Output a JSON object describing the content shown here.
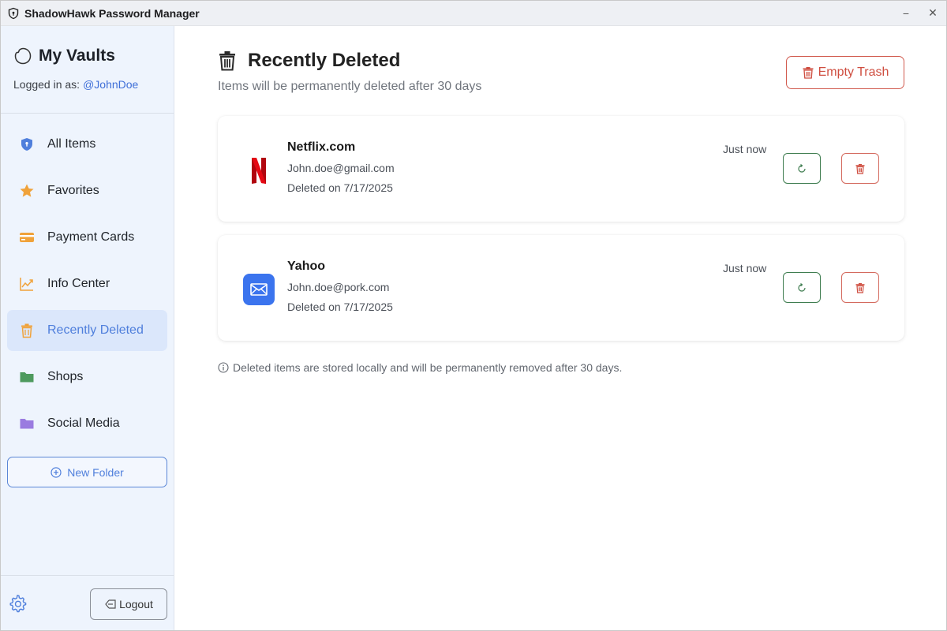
{
  "window": {
    "title": "ShadowHawk Password Manager",
    "controls": {
      "minimize": "−",
      "close": "✕"
    }
  },
  "sidebar": {
    "vault_title": "My Vaults",
    "logged_in_label": "Logged in as:",
    "username": "@JohnDoe",
    "items": [
      {
        "label": "All Items",
        "icon": "shield-icon",
        "color": "#4f7fdc"
      },
      {
        "label": "Favorites",
        "icon": "star-icon",
        "color": "#f0a23a"
      },
      {
        "label": "Payment Cards",
        "icon": "credit-card-icon",
        "color": "#f0a23a"
      },
      {
        "label": "Info Center",
        "icon": "chart-line-icon",
        "color": "#f0a23a"
      },
      {
        "label": "Recently Deleted",
        "icon": "trash-icon",
        "color": "#f0a23a",
        "active": true
      },
      {
        "label": "Shops",
        "icon": "folder-icon",
        "color": "#4e9a5e"
      },
      {
        "label": "Social Media",
        "icon": "folder-icon",
        "color": "#9a7be0"
      }
    ],
    "new_folder_label": "New Folder",
    "logout_label": "Logout"
  },
  "main": {
    "title": "Recently Deleted",
    "subtitle": "Items will be permanently deleted after 30 days",
    "empty_trash_label": "Empty Trash",
    "items": [
      {
        "site": "Netflix.com",
        "email": "John.doe@gmail.com",
        "deleted": "Deleted on 7/17/2025",
        "when": "Just now",
        "logo": "netflix-logo-icon"
      },
      {
        "site": "Yahoo",
        "email": "John.doe@pork.com",
        "deleted": "Deleted on 7/17/2025",
        "when": "Just now",
        "logo": "mail-icon"
      }
    ],
    "footnote": "Deleted items are stored locally and will be permanently removed after 30 days."
  },
  "colors": {
    "accent": "#4f7fdc",
    "danger": "#cf4e40",
    "restore": "#3f7d50",
    "sidebar_bg": "#eef4fd"
  }
}
